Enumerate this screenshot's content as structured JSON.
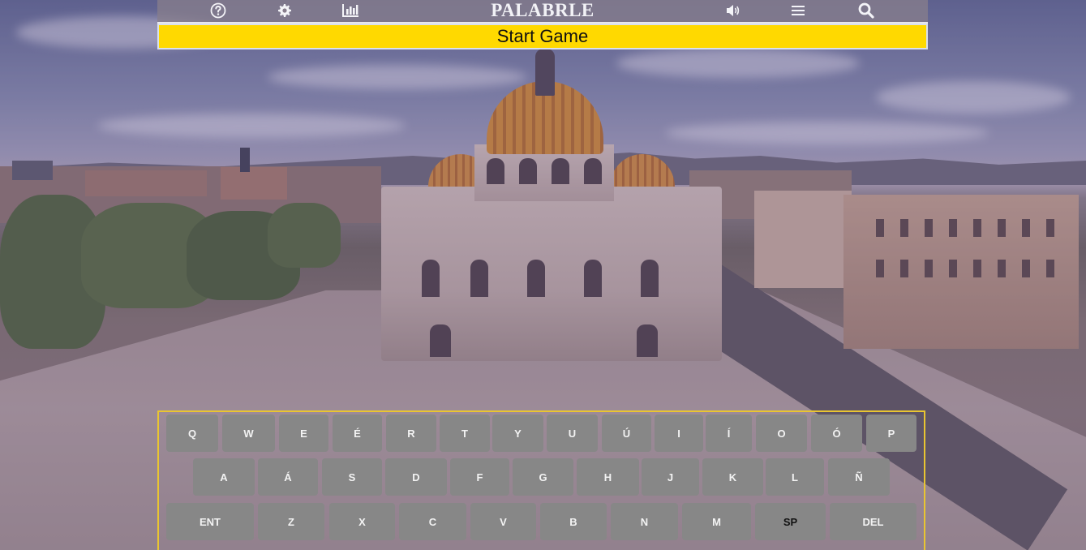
{
  "header": {
    "title": "PALABRLE",
    "icons": [
      "help-icon",
      "settings-icon",
      "stats-icon",
      "sound-icon",
      "menu-icon",
      "search-icon"
    ]
  },
  "start_button": {
    "label": "Start Game"
  },
  "keyboard": {
    "row1": [
      "Q",
      "W",
      "E",
      "É",
      "R",
      "T",
      "Y",
      "U",
      "Ú",
      "I",
      "Í",
      "O",
      "Ó",
      "P"
    ],
    "row2": [
      "A",
      "Á",
      "S",
      "D",
      "F",
      "G",
      "H",
      "J",
      "K",
      "L",
      "Ñ"
    ],
    "row3": [
      "ENT",
      "Z",
      "X",
      "C",
      "V",
      "B",
      "N",
      "M",
      "SP",
      "DEL"
    ]
  },
  "colors": {
    "start_bar": "#ffd900",
    "key_bg": "#878787",
    "keyboard_border": "#e9c531",
    "header_bg": "#877d8c"
  }
}
